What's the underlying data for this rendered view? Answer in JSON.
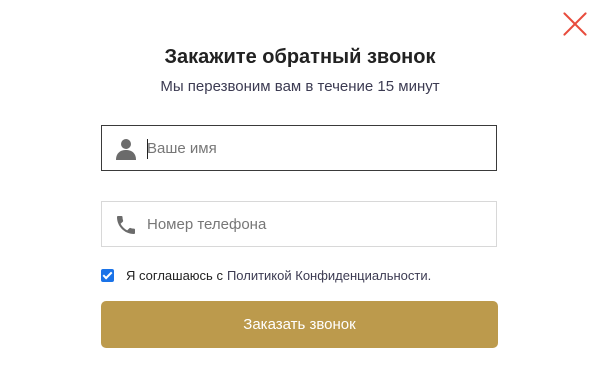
{
  "modal": {
    "title": "Закажите обратный звонок",
    "subtitle": "Мы перезвоним вам в течение 15 минут",
    "close_icon": "close-icon"
  },
  "form": {
    "name_field": {
      "placeholder": "Ваше имя",
      "value": "",
      "icon": "user-icon"
    },
    "phone_field": {
      "placeholder": "Номер телефона",
      "value": "",
      "icon": "phone-icon"
    },
    "consent": {
      "checked": true,
      "text": "Я соглашаюсь с",
      "link_text": "Политикой Конфиденциальности."
    },
    "submit_label": "Заказать звонок"
  },
  "colors": {
    "accent": "#bc9a4c",
    "close": "#e84c3d",
    "checkbox": "#1a73e8"
  }
}
